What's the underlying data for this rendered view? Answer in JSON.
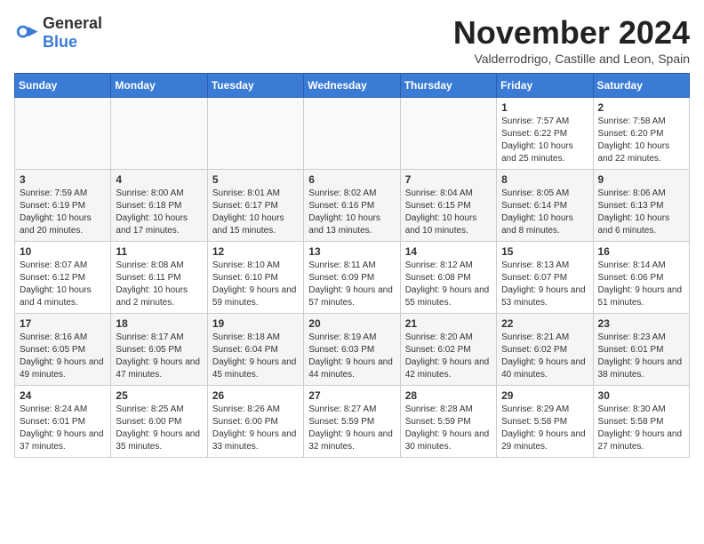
{
  "logo": {
    "general": "General",
    "blue": "Blue"
  },
  "title": "November 2024",
  "subtitle": "Valderrodrigo, Castille and Leon, Spain",
  "days_of_week": [
    "Sunday",
    "Monday",
    "Tuesday",
    "Wednesday",
    "Thursday",
    "Friday",
    "Saturday"
  ],
  "weeks": [
    [
      {
        "day": "",
        "info": ""
      },
      {
        "day": "",
        "info": ""
      },
      {
        "day": "",
        "info": ""
      },
      {
        "day": "",
        "info": ""
      },
      {
        "day": "",
        "info": ""
      },
      {
        "day": "1",
        "info": "Sunrise: 7:57 AM\nSunset: 6:22 PM\nDaylight: 10 hours and 25 minutes."
      },
      {
        "day": "2",
        "info": "Sunrise: 7:58 AM\nSunset: 6:20 PM\nDaylight: 10 hours and 22 minutes."
      }
    ],
    [
      {
        "day": "3",
        "info": "Sunrise: 7:59 AM\nSunset: 6:19 PM\nDaylight: 10 hours and 20 minutes."
      },
      {
        "day": "4",
        "info": "Sunrise: 8:00 AM\nSunset: 6:18 PM\nDaylight: 10 hours and 17 minutes."
      },
      {
        "day": "5",
        "info": "Sunrise: 8:01 AM\nSunset: 6:17 PM\nDaylight: 10 hours and 15 minutes."
      },
      {
        "day": "6",
        "info": "Sunrise: 8:02 AM\nSunset: 6:16 PM\nDaylight: 10 hours and 13 minutes."
      },
      {
        "day": "7",
        "info": "Sunrise: 8:04 AM\nSunset: 6:15 PM\nDaylight: 10 hours and 10 minutes."
      },
      {
        "day": "8",
        "info": "Sunrise: 8:05 AM\nSunset: 6:14 PM\nDaylight: 10 hours and 8 minutes."
      },
      {
        "day": "9",
        "info": "Sunrise: 8:06 AM\nSunset: 6:13 PM\nDaylight: 10 hours and 6 minutes."
      }
    ],
    [
      {
        "day": "10",
        "info": "Sunrise: 8:07 AM\nSunset: 6:12 PM\nDaylight: 10 hours and 4 minutes."
      },
      {
        "day": "11",
        "info": "Sunrise: 8:08 AM\nSunset: 6:11 PM\nDaylight: 10 hours and 2 minutes."
      },
      {
        "day": "12",
        "info": "Sunrise: 8:10 AM\nSunset: 6:10 PM\nDaylight: 9 hours and 59 minutes."
      },
      {
        "day": "13",
        "info": "Sunrise: 8:11 AM\nSunset: 6:09 PM\nDaylight: 9 hours and 57 minutes."
      },
      {
        "day": "14",
        "info": "Sunrise: 8:12 AM\nSunset: 6:08 PM\nDaylight: 9 hours and 55 minutes."
      },
      {
        "day": "15",
        "info": "Sunrise: 8:13 AM\nSunset: 6:07 PM\nDaylight: 9 hours and 53 minutes."
      },
      {
        "day": "16",
        "info": "Sunrise: 8:14 AM\nSunset: 6:06 PM\nDaylight: 9 hours and 51 minutes."
      }
    ],
    [
      {
        "day": "17",
        "info": "Sunrise: 8:16 AM\nSunset: 6:05 PM\nDaylight: 9 hours and 49 minutes."
      },
      {
        "day": "18",
        "info": "Sunrise: 8:17 AM\nSunset: 6:05 PM\nDaylight: 9 hours and 47 minutes."
      },
      {
        "day": "19",
        "info": "Sunrise: 8:18 AM\nSunset: 6:04 PM\nDaylight: 9 hours and 45 minutes."
      },
      {
        "day": "20",
        "info": "Sunrise: 8:19 AM\nSunset: 6:03 PM\nDaylight: 9 hours and 44 minutes."
      },
      {
        "day": "21",
        "info": "Sunrise: 8:20 AM\nSunset: 6:02 PM\nDaylight: 9 hours and 42 minutes."
      },
      {
        "day": "22",
        "info": "Sunrise: 8:21 AM\nSunset: 6:02 PM\nDaylight: 9 hours and 40 minutes."
      },
      {
        "day": "23",
        "info": "Sunrise: 8:23 AM\nSunset: 6:01 PM\nDaylight: 9 hours and 38 minutes."
      }
    ],
    [
      {
        "day": "24",
        "info": "Sunrise: 8:24 AM\nSunset: 6:01 PM\nDaylight: 9 hours and 37 minutes."
      },
      {
        "day": "25",
        "info": "Sunrise: 8:25 AM\nSunset: 6:00 PM\nDaylight: 9 hours and 35 minutes."
      },
      {
        "day": "26",
        "info": "Sunrise: 8:26 AM\nSunset: 6:00 PM\nDaylight: 9 hours and 33 minutes."
      },
      {
        "day": "27",
        "info": "Sunrise: 8:27 AM\nSunset: 5:59 PM\nDaylight: 9 hours and 32 minutes."
      },
      {
        "day": "28",
        "info": "Sunrise: 8:28 AM\nSunset: 5:59 PM\nDaylight: 9 hours and 30 minutes."
      },
      {
        "day": "29",
        "info": "Sunrise: 8:29 AM\nSunset: 5:58 PM\nDaylight: 9 hours and 29 minutes."
      },
      {
        "day": "30",
        "info": "Sunrise: 8:30 AM\nSunset: 5:58 PM\nDaylight: 9 hours and 27 minutes."
      }
    ]
  ]
}
